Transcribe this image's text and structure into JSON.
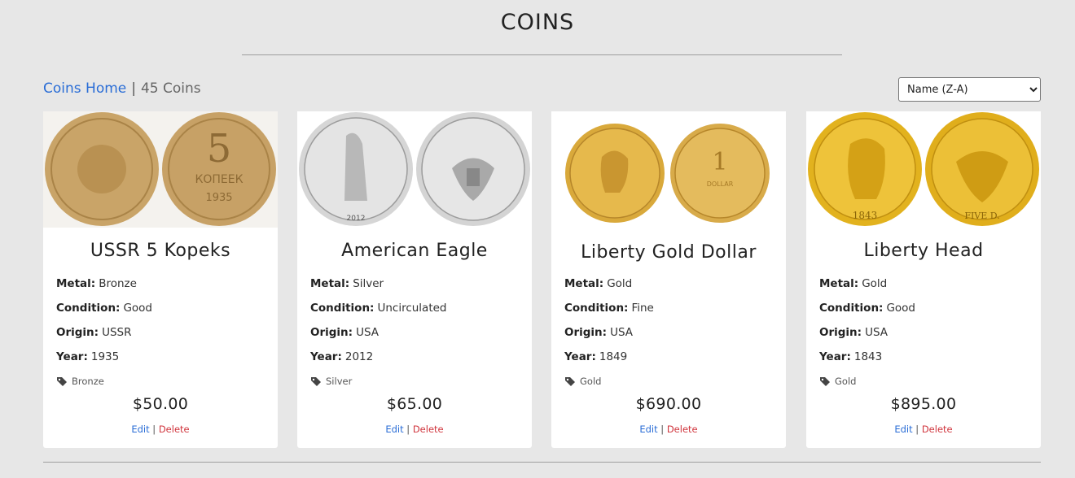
{
  "header": {
    "title": "COINS"
  },
  "breadcrumb": {
    "home_label": "Coins Home",
    "separator": "|",
    "count_label": "45 Coins"
  },
  "sort": {
    "selected": "Name (Z-A)"
  },
  "labels": {
    "metal": "Metal:",
    "condition": "Condition:",
    "origin": "Origin:",
    "year": "Year:",
    "edit": "Edit",
    "separator": "|",
    "delete": "Delete"
  },
  "colors": {
    "link": "#2a6dd6",
    "delete": "#d0343c",
    "background": "#e7e7e7",
    "card": "#ffffff"
  },
  "coins": [
    {
      "name": "USSR 5 Kopeks",
      "metal": "Bronze",
      "condition": "Good",
      "origin": "USSR",
      "year": "1935",
      "tag": "Bronze",
      "price": "$50.00",
      "image_icon": "bronze-coin-icon"
    },
    {
      "name": "American Eagle",
      "metal": "Silver",
      "condition": "Uncirculated",
      "origin": "USA",
      "year": "2012",
      "tag": "Silver",
      "price": "$65.00",
      "image_icon": "silver-coin-icon"
    },
    {
      "name": "Liberty Gold Dollar",
      "metal": "Gold",
      "condition": "Fine",
      "origin": "USA",
      "year": "1849",
      "tag": "Gold",
      "price": "$690.00",
      "image_icon": "gold-coin-icon"
    },
    {
      "name": "Liberty Head",
      "metal": "Gold",
      "condition": "Good",
      "origin": "USA",
      "year": "1843",
      "tag": "Gold",
      "price": "$895.00",
      "image_icon": "gold-coin-icon"
    }
  ]
}
